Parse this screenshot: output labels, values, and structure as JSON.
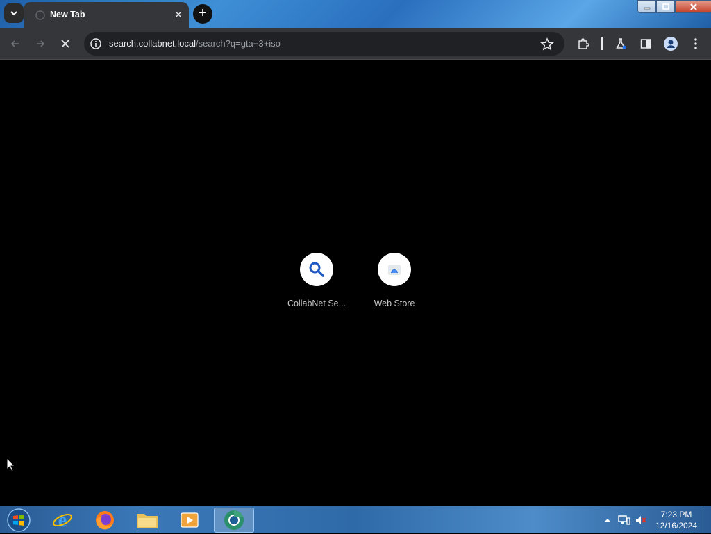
{
  "browser": {
    "tab": {
      "title": "New Tab",
      "close_symbol": "✕",
      "favicon": "chrome-newtab-icon"
    },
    "new_tab_symbol": "+",
    "window_buttons": [
      "minimize-icon",
      "maximize-icon",
      "close-icon"
    ],
    "toolbar": {
      "back_icon": "back-arrow-icon",
      "forward_icon": "forward-arrow-icon",
      "stop_icon": "stop-loading-icon",
      "url_host": "search.collabnet.local",
      "url_path": "/search?q=gta+3+iso",
      "right_icons": [
        "star-icon",
        "extensions-icon",
        "labs-flask-icon",
        "side-panel-icon",
        "profile-icon",
        "menu-kebab-icon"
      ]
    }
  },
  "newtab": {
    "shortcuts": [
      {
        "label": "CollabNet Se...",
        "icon": "search-magnifier-icon"
      },
      {
        "label": "Web Store",
        "icon": "web-store-icon"
      }
    ]
  },
  "taskbar": {
    "start_icon": "windows-start-orb-icon",
    "pinned": [
      "internet-explorer-icon",
      "firefox-icon",
      "file-explorer-icon",
      "media-player-icon",
      "chrome-icon"
    ],
    "tray_icons": [
      "tray-expand-icon",
      "network-icon",
      "volume-muted-icon"
    ],
    "clock": {
      "time": "7:23 PM",
      "date": "12/16/2024"
    }
  },
  "colors": {
    "toolbar_bg": "#35363a",
    "omnibox_bg": "#202124",
    "page_bg": "#000000",
    "accent_blue": "#1a73e8"
  }
}
